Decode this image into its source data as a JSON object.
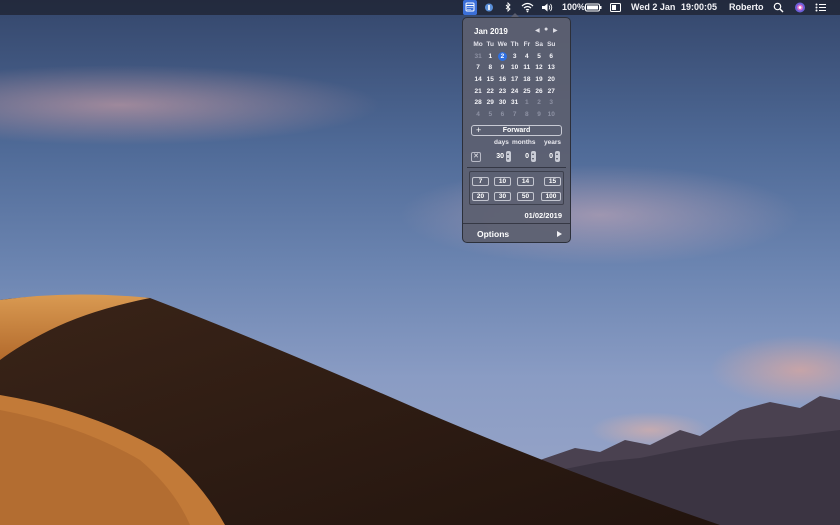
{
  "menubar": {
    "battery_pct": "100%",
    "date": "Wed 2 Jan",
    "time": "19:00:05",
    "user": "Roberto",
    "icons": [
      "calendar-icon",
      "shield-icon",
      "bluetooth-icon",
      "wifi-icon",
      "volume-icon",
      "battery-icon",
      "display-icon",
      "search-icon",
      "siri-icon",
      "menu-list-icon"
    ]
  },
  "calendar": {
    "month_label": "Jan 2019",
    "weekdays": [
      "Mo",
      "Tu",
      "We",
      "Th",
      "Fr",
      "Sa",
      "Su"
    ],
    "weeks": [
      [
        "31",
        "1",
        "2",
        "3",
        "4",
        "5",
        "6"
      ],
      [
        "7",
        "8",
        "9",
        "10",
        "11",
        "12",
        "13"
      ],
      [
        "14",
        "15",
        "16",
        "17",
        "18",
        "19",
        "20"
      ],
      [
        "21",
        "22",
        "23",
        "24",
        "25",
        "26",
        "27"
      ],
      [
        "28",
        "29",
        "30",
        "31",
        "1",
        "2",
        "3"
      ],
      [
        "4",
        "5",
        "6",
        "7",
        "8",
        "9",
        "10"
      ]
    ],
    "today": "2"
  },
  "calculator": {
    "direction_label": "Forward",
    "units": {
      "days": "days",
      "months": "months",
      "years": "years"
    },
    "values": {
      "days": "30",
      "months": "0",
      "years": "0"
    },
    "presets": [
      "7",
      "10",
      "14",
      "15",
      "20",
      "30",
      "50",
      "100"
    ],
    "result": "01/02/2019"
  },
  "options_label": "Options",
  "colors": {
    "accent": "#2f6fe0",
    "popover": "#5c6070"
  }
}
